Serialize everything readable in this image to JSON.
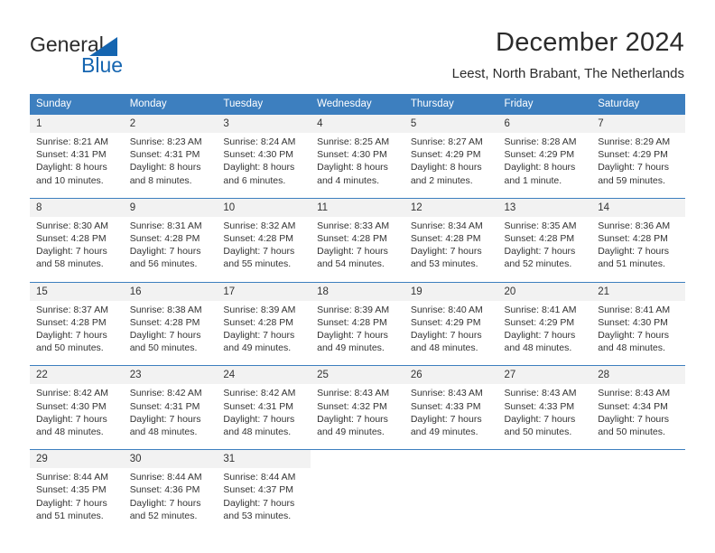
{
  "logo": {
    "text_primary": "General",
    "text_secondary": "Blue",
    "accent_color": "#1565b0"
  },
  "header": {
    "title": "December 2024",
    "subtitle": "Leest, North Brabant, The Netherlands"
  },
  "theme": {
    "header_row_color": "#3d7fbf",
    "daynum_band_color": "#f2f2f2",
    "text_color": "#333333"
  },
  "calendar": {
    "weekday_headers": [
      "Sunday",
      "Monday",
      "Tuesday",
      "Wednesday",
      "Thursday",
      "Friday",
      "Saturday"
    ],
    "weeks": [
      [
        {
          "day": "1",
          "sunrise": "Sunrise: 8:21 AM",
          "sunset": "Sunset: 4:31 PM",
          "daylight_1": "Daylight: 8 hours",
          "daylight_2": "and 10 minutes."
        },
        {
          "day": "2",
          "sunrise": "Sunrise: 8:23 AM",
          "sunset": "Sunset: 4:31 PM",
          "daylight_1": "Daylight: 8 hours",
          "daylight_2": "and 8 minutes."
        },
        {
          "day": "3",
          "sunrise": "Sunrise: 8:24 AM",
          "sunset": "Sunset: 4:30 PM",
          "daylight_1": "Daylight: 8 hours",
          "daylight_2": "and 6 minutes."
        },
        {
          "day": "4",
          "sunrise": "Sunrise: 8:25 AM",
          "sunset": "Sunset: 4:30 PM",
          "daylight_1": "Daylight: 8 hours",
          "daylight_2": "and 4 minutes."
        },
        {
          "day": "5",
          "sunrise": "Sunrise: 8:27 AM",
          "sunset": "Sunset: 4:29 PM",
          "daylight_1": "Daylight: 8 hours",
          "daylight_2": "and 2 minutes."
        },
        {
          "day": "6",
          "sunrise": "Sunrise: 8:28 AM",
          "sunset": "Sunset: 4:29 PM",
          "daylight_1": "Daylight: 8 hours",
          "daylight_2": "and 1 minute."
        },
        {
          "day": "7",
          "sunrise": "Sunrise: 8:29 AM",
          "sunset": "Sunset: 4:29 PM",
          "daylight_1": "Daylight: 7 hours",
          "daylight_2": "and 59 minutes."
        }
      ],
      [
        {
          "day": "8",
          "sunrise": "Sunrise: 8:30 AM",
          "sunset": "Sunset: 4:28 PM",
          "daylight_1": "Daylight: 7 hours",
          "daylight_2": "and 58 minutes."
        },
        {
          "day": "9",
          "sunrise": "Sunrise: 8:31 AM",
          "sunset": "Sunset: 4:28 PM",
          "daylight_1": "Daylight: 7 hours",
          "daylight_2": "and 56 minutes."
        },
        {
          "day": "10",
          "sunrise": "Sunrise: 8:32 AM",
          "sunset": "Sunset: 4:28 PM",
          "daylight_1": "Daylight: 7 hours",
          "daylight_2": "and 55 minutes."
        },
        {
          "day": "11",
          "sunrise": "Sunrise: 8:33 AM",
          "sunset": "Sunset: 4:28 PM",
          "daylight_1": "Daylight: 7 hours",
          "daylight_2": "and 54 minutes."
        },
        {
          "day": "12",
          "sunrise": "Sunrise: 8:34 AM",
          "sunset": "Sunset: 4:28 PM",
          "daylight_1": "Daylight: 7 hours",
          "daylight_2": "and 53 minutes."
        },
        {
          "day": "13",
          "sunrise": "Sunrise: 8:35 AM",
          "sunset": "Sunset: 4:28 PM",
          "daylight_1": "Daylight: 7 hours",
          "daylight_2": "and 52 minutes."
        },
        {
          "day": "14",
          "sunrise": "Sunrise: 8:36 AM",
          "sunset": "Sunset: 4:28 PM",
          "daylight_1": "Daylight: 7 hours",
          "daylight_2": "and 51 minutes."
        }
      ],
      [
        {
          "day": "15",
          "sunrise": "Sunrise: 8:37 AM",
          "sunset": "Sunset: 4:28 PM",
          "daylight_1": "Daylight: 7 hours",
          "daylight_2": "and 50 minutes."
        },
        {
          "day": "16",
          "sunrise": "Sunrise: 8:38 AM",
          "sunset": "Sunset: 4:28 PM",
          "daylight_1": "Daylight: 7 hours",
          "daylight_2": "and 50 minutes."
        },
        {
          "day": "17",
          "sunrise": "Sunrise: 8:39 AM",
          "sunset": "Sunset: 4:28 PM",
          "daylight_1": "Daylight: 7 hours",
          "daylight_2": "and 49 minutes."
        },
        {
          "day": "18",
          "sunrise": "Sunrise: 8:39 AM",
          "sunset": "Sunset: 4:28 PM",
          "daylight_1": "Daylight: 7 hours",
          "daylight_2": "and 49 minutes."
        },
        {
          "day": "19",
          "sunrise": "Sunrise: 8:40 AM",
          "sunset": "Sunset: 4:29 PM",
          "daylight_1": "Daylight: 7 hours",
          "daylight_2": "and 48 minutes."
        },
        {
          "day": "20",
          "sunrise": "Sunrise: 8:41 AM",
          "sunset": "Sunset: 4:29 PM",
          "daylight_1": "Daylight: 7 hours",
          "daylight_2": "and 48 minutes."
        },
        {
          "day": "21",
          "sunrise": "Sunrise: 8:41 AM",
          "sunset": "Sunset: 4:30 PM",
          "daylight_1": "Daylight: 7 hours",
          "daylight_2": "and 48 minutes."
        }
      ],
      [
        {
          "day": "22",
          "sunrise": "Sunrise: 8:42 AM",
          "sunset": "Sunset: 4:30 PM",
          "daylight_1": "Daylight: 7 hours",
          "daylight_2": "and 48 minutes."
        },
        {
          "day": "23",
          "sunrise": "Sunrise: 8:42 AM",
          "sunset": "Sunset: 4:31 PM",
          "daylight_1": "Daylight: 7 hours",
          "daylight_2": "and 48 minutes."
        },
        {
          "day": "24",
          "sunrise": "Sunrise: 8:42 AM",
          "sunset": "Sunset: 4:31 PM",
          "daylight_1": "Daylight: 7 hours",
          "daylight_2": "and 48 minutes."
        },
        {
          "day": "25",
          "sunrise": "Sunrise: 8:43 AM",
          "sunset": "Sunset: 4:32 PM",
          "daylight_1": "Daylight: 7 hours",
          "daylight_2": "and 49 minutes."
        },
        {
          "day": "26",
          "sunrise": "Sunrise: 8:43 AM",
          "sunset": "Sunset: 4:33 PM",
          "daylight_1": "Daylight: 7 hours",
          "daylight_2": "and 49 minutes."
        },
        {
          "day": "27",
          "sunrise": "Sunrise: 8:43 AM",
          "sunset": "Sunset: 4:33 PM",
          "daylight_1": "Daylight: 7 hours",
          "daylight_2": "and 50 minutes."
        },
        {
          "day": "28",
          "sunrise": "Sunrise: 8:43 AM",
          "sunset": "Sunset: 4:34 PM",
          "daylight_1": "Daylight: 7 hours",
          "daylight_2": "and 50 minutes."
        }
      ],
      [
        {
          "day": "29",
          "sunrise": "Sunrise: 8:44 AM",
          "sunset": "Sunset: 4:35 PM",
          "daylight_1": "Daylight: 7 hours",
          "daylight_2": "and 51 minutes."
        },
        {
          "day": "30",
          "sunrise": "Sunrise: 8:44 AM",
          "sunset": "Sunset: 4:36 PM",
          "daylight_1": "Daylight: 7 hours",
          "daylight_2": "and 52 minutes."
        },
        {
          "day": "31",
          "sunrise": "Sunrise: 8:44 AM",
          "sunset": "Sunset: 4:37 PM",
          "daylight_1": "Daylight: 7 hours",
          "daylight_2": "and 53 minutes."
        },
        {
          "day": "",
          "sunrise": "",
          "sunset": "",
          "daylight_1": "",
          "daylight_2": ""
        },
        {
          "day": "",
          "sunrise": "",
          "sunset": "",
          "daylight_1": "",
          "daylight_2": ""
        },
        {
          "day": "",
          "sunrise": "",
          "sunset": "",
          "daylight_1": "",
          "daylight_2": ""
        },
        {
          "day": "",
          "sunrise": "",
          "sunset": "",
          "daylight_1": "",
          "daylight_2": ""
        }
      ]
    ]
  }
}
